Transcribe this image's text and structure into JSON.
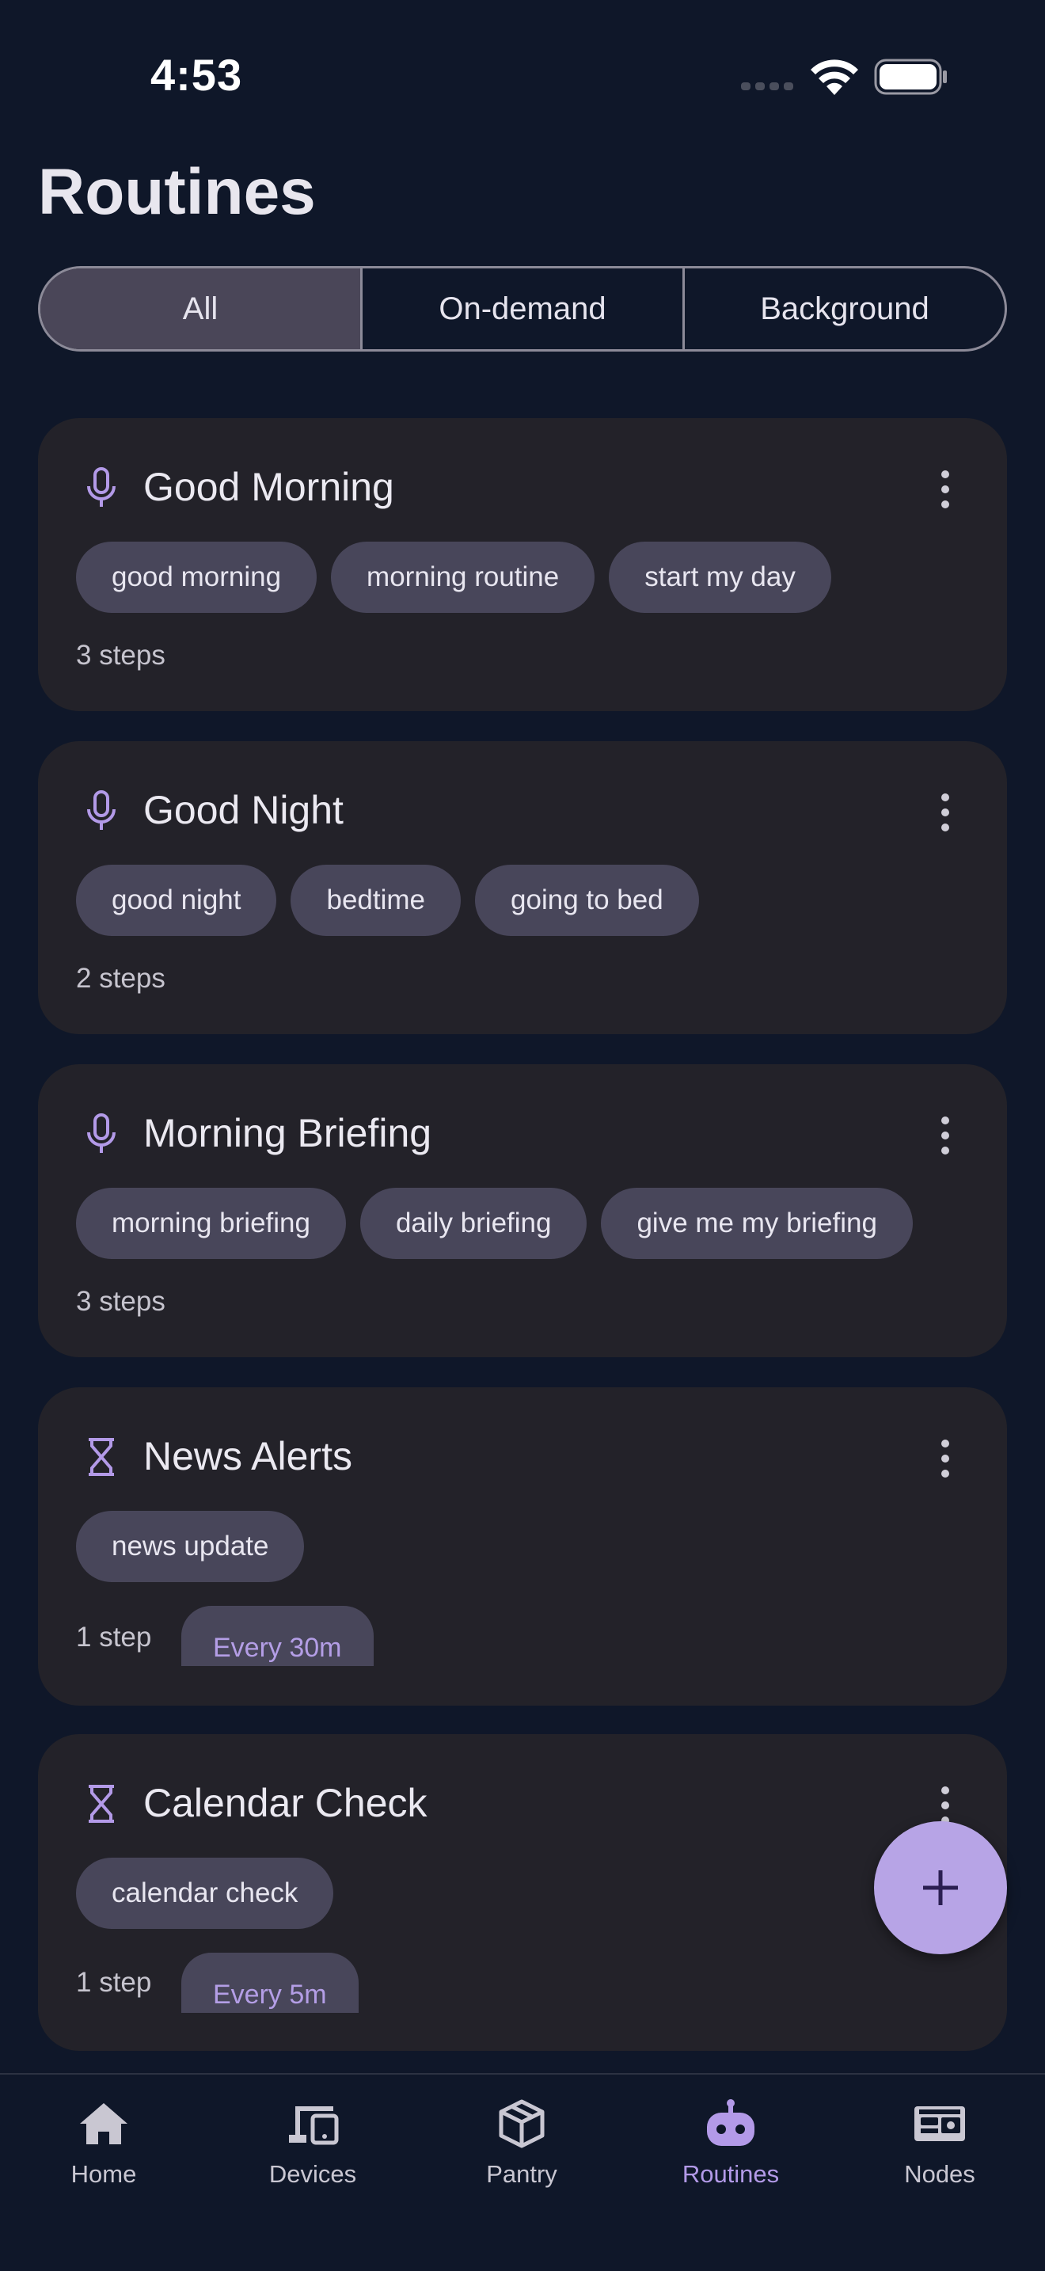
{
  "status_bar": {
    "time": "4:53"
  },
  "page_title": "Routines",
  "filter_tabs": [
    {
      "label": "All",
      "selected": true
    },
    {
      "label": "On-demand",
      "selected": false
    },
    {
      "label": "Background",
      "selected": false
    }
  ],
  "routines": [
    {
      "title": "Good Morning",
      "icon": "microphone-icon",
      "phrases": [
        "good morning",
        "morning routine",
        "start my day"
      ],
      "steps": "3 steps"
    },
    {
      "title": "Good Night",
      "icon": "microphone-icon",
      "phrases": [
        "good night",
        "bedtime",
        "going to bed"
      ],
      "steps": "2 steps"
    },
    {
      "title": "Morning Briefing",
      "icon": "microphone-icon",
      "phrases": [
        "morning briefing",
        "daily briefing",
        "give me my briefing"
      ],
      "steps": "3 steps"
    },
    {
      "title": "News Alerts",
      "icon": "hourglass-icon",
      "phrases": [
        "news update"
      ],
      "steps": "1 step",
      "schedule": "Every 30m"
    },
    {
      "title": "Calendar Check",
      "icon": "hourglass-icon",
      "phrases": [
        "calendar check"
      ],
      "steps": "1 step",
      "schedule": "Every 5m"
    }
  ],
  "fab": {
    "icon": "plus-icon"
  },
  "bottom_nav": [
    {
      "label": "Home",
      "icon": "home-icon",
      "active": false
    },
    {
      "label": "Devices",
      "icon": "devices-icon",
      "active": false
    },
    {
      "label": "Pantry",
      "icon": "package-icon",
      "active": false
    },
    {
      "label": "Routines",
      "icon": "robot-icon",
      "active": true
    },
    {
      "label": "Nodes",
      "icon": "server-icon",
      "active": false
    }
  ],
  "colors": {
    "background": "#0f1729",
    "card": "#232229",
    "chip": "#48465a",
    "accent": "#b7a4e6",
    "active_nav": "#b39ae8"
  }
}
